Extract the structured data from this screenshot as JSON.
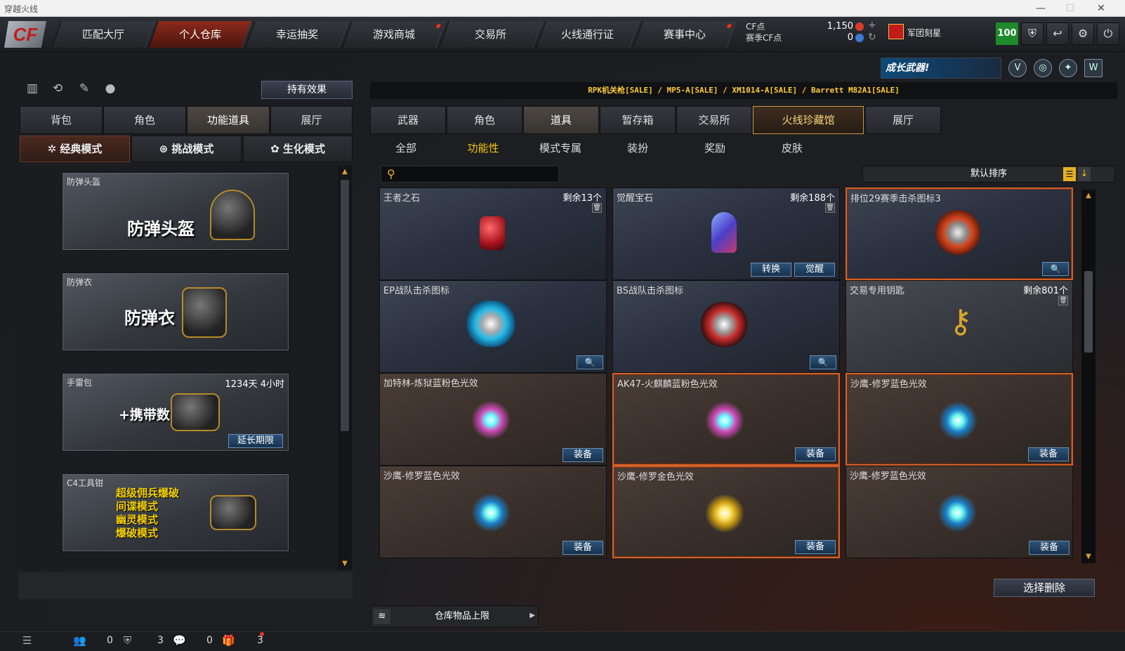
{
  "window": {
    "title": "穿越火线"
  },
  "nav": {
    "items": [
      "匹配大厅",
      "个人仓库",
      "幸运抽奖",
      "游戏商城",
      "交易所",
      "火线通行证",
      "赛事中心"
    ],
    "active_index": 1
  },
  "currency": {
    "cf_label": "CF点",
    "season_label": "赛季CF点",
    "cf_value": "1,150",
    "season_value": "0"
  },
  "user": {
    "rank_name": "军团刻星",
    "level": "100"
  },
  "promo": {
    "text": "成长武器!"
  },
  "left": {
    "effect_button": "持有效果",
    "tabs": [
      "背包",
      "角色",
      "功能道具",
      "展厅"
    ],
    "active_tab": 2,
    "modes": [
      "经典模式",
      "挑战模式",
      "生化模式"
    ],
    "items": [
      {
        "name": "防弹头盔",
        "big": "防弹头盔"
      },
      {
        "name": "防弹衣",
        "big": "防弹衣"
      },
      {
        "name": "手雷包",
        "big": "+携带数",
        "time": "1234天 4小时",
        "button": "延长期限"
      },
      {
        "name": "C4工具钳",
        "lines": [
          "超级佣兵爆破",
          "间谍模式",
          "幽灵模式",
          "爆破模式"
        ]
      }
    ]
  },
  "right": {
    "ticker": "RPK机关枪[SALE] / MP5-A[SALE] / XM1014-A[SALE] / Barrett M82A1[SALE]",
    "tabs": [
      "武器",
      "角色",
      "道具",
      "暂存箱",
      "交易所",
      "火线珍藏馆",
      "展厅"
    ],
    "active_tab": 2,
    "subtabs": [
      "全部",
      "功能性",
      "模式专属",
      "装扮",
      "奖励",
      "皮肤"
    ],
    "active_subtab": 1,
    "search_placeholder": "",
    "sort_label": "默认排序",
    "cards": [
      {
        "title": "王者之石",
        "count": "剩余13个"
      },
      {
        "title": "觉醒宝石",
        "count": "剩余188个",
        "buttons": [
          "转换",
          "觉醒"
        ]
      },
      {
        "title": "排位29赛季击杀图标3"
      },
      {
        "title": "EP战队击杀图标"
      },
      {
        "title": "BS战队击杀图标"
      },
      {
        "title": "交易专用钥匙",
        "count": "剩余801个"
      },
      {
        "title": "加特林-炼狱蓝粉色光效",
        "button": "装备"
      },
      {
        "title": "AK47-火麒麟蓝粉色光效",
        "button": "装备"
      },
      {
        "title": "沙鹰-修罗蓝色光效",
        "button": "装备"
      },
      {
        "title": "沙鹰-修罗蓝色光效",
        "button": "装备"
      },
      {
        "title": "沙鹰-修罗金色光效",
        "button": "装备"
      },
      {
        "title": "沙鹰-修罗蓝色光效",
        "button": "装备"
      }
    ],
    "delete_button": "选择删除",
    "storage_label": "仓库物品上限"
  },
  "statusbar": {
    "friends": "0",
    "clan": "3",
    "messages": "0",
    "gifts": "3"
  },
  "colors": {
    "accent": "#f5c400",
    "active_nav": "#8c2a1b",
    "select_border": "#d0602a",
    "button_blue": "#2c5278"
  }
}
